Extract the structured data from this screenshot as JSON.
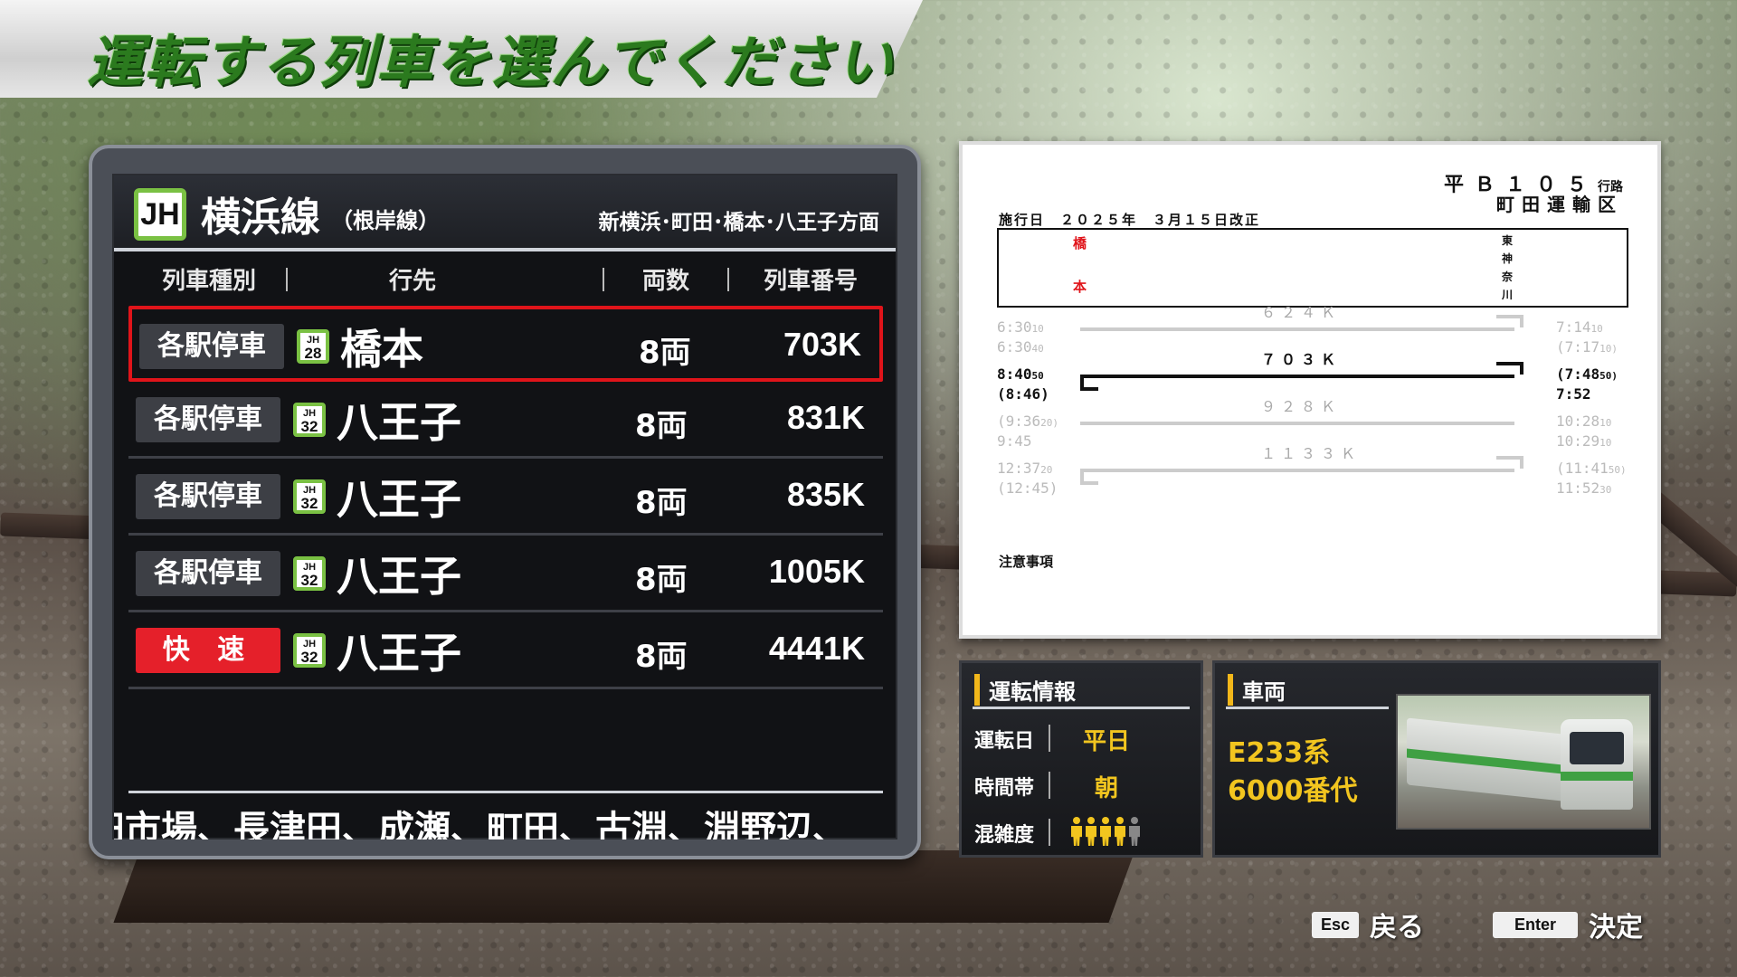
{
  "page": {
    "title": "運転する列車を選んでください"
  },
  "line": {
    "code": "JH",
    "name": "横浜線",
    "sub": "（根岸線）",
    "direction": "新横浜･町田･橋本･八王子方面",
    "color": "#7ac143"
  },
  "columns": {
    "type": "列車種別",
    "dest": "行先",
    "cars": "両数",
    "number": "列車番号"
  },
  "trains": [
    {
      "type": "各駅停車",
      "line_code": "JH",
      "station_no": "28",
      "dest": "橋本",
      "cars": "8両",
      "number": "703K",
      "selected": true,
      "rapid": false
    },
    {
      "type": "各駅停車",
      "line_code": "JH",
      "station_no": "32",
      "dest": "八王子",
      "cars": "8両",
      "number": "831K",
      "selected": false,
      "rapid": false
    },
    {
      "type": "各駅停車",
      "line_code": "JH",
      "station_no": "32",
      "dest": "八王子",
      "cars": "8両",
      "number": "835K",
      "selected": false,
      "rapid": false
    },
    {
      "type": "各駅停車",
      "line_code": "JH",
      "station_no": "32",
      "dest": "八王子",
      "cars": "8両",
      "number": "1005K",
      "selected": false,
      "rapid": false
    },
    {
      "type": "快 速",
      "line_code": "JH",
      "station_no": "32",
      "dest": "八王子",
      "cars": "8両",
      "number": "4441K",
      "selected": false,
      "rapid": true
    }
  ],
  "stops_marquee": "田市場、長津田、成瀬、町田、古淵、淵野辺、",
  "timetable": {
    "route": "平Ｂ１０５",
    "route_suffix": "行路",
    "depot": "町田運輸区",
    "effective": "施行日　２０２５年　３月１５日改正",
    "west_station": [
      "橋",
      "本"
    ],
    "east_station": [
      "東",
      "神",
      "奈",
      "川"
    ],
    "runs": [
      {
        "train": "６２４Ｋ",
        "dep": [
          "6:30",
          "10",
          "6:30",
          "40"
        ],
        "arr": [
          "7:14",
          "10",
          "(7:17",
          "10)"
        ],
        "active": false
      },
      {
        "train": "７０３Ｋ",
        "dep": [
          "8:40",
          "50",
          "(8:46)",
          ""
        ],
        "arr": [
          "(7:48",
          "50)",
          "7:52",
          ""
        ],
        "active": true
      },
      {
        "train": "９２８Ｋ",
        "dep": [
          "(9:36",
          "20)",
          "9:45",
          ""
        ],
        "arr": [
          "10:28",
          "10",
          "10:29",
          "10"
        ],
        "active": false
      },
      {
        "train": "１１３３Ｋ",
        "dep": [
          "12:37",
          "20",
          "(12:45)",
          ""
        ],
        "arr": [
          "(11:41",
          "50)",
          "11:52",
          "30"
        ],
        "active": false
      }
    ],
    "notes_label": "注意事項"
  },
  "operation": {
    "title": "運転情報",
    "day_label": "運転日",
    "day_value": "平日",
    "time_label": "時間帯",
    "time_value": "朝",
    "crowd_label": "混雑度",
    "crowd_level": 4,
    "crowd_max": 5
  },
  "vehicle": {
    "title": "車両",
    "series": "E233系",
    "subseries": "6000番代"
  },
  "hints": {
    "back_key": "Esc",
    "back_label": "戻る",
    "ok_key": "Enter",
    "ok_label": "決定"
  },
  "colors": {
    "accent_green": "#2b7a1e",
    "select_red": "#e0141a",
    "rapid_red": "#e5202a",
    "info_yellow": "#f2c51f"
  }
}
